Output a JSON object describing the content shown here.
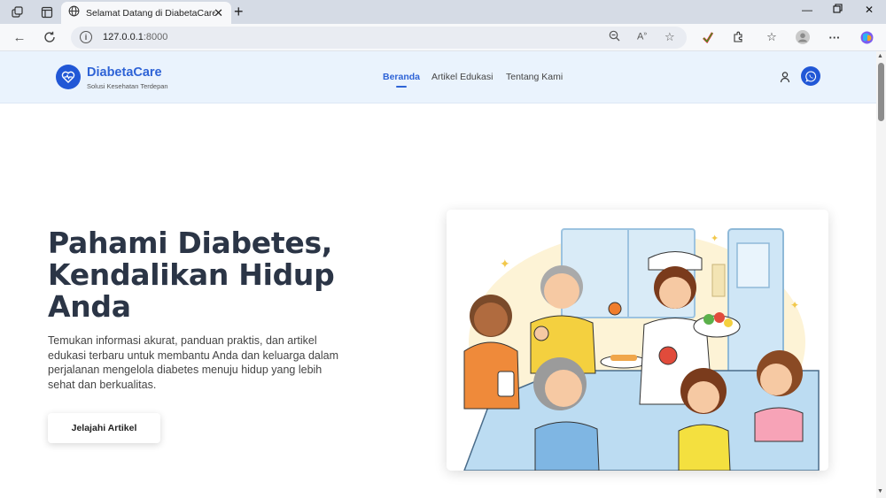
{
  "browser": {
    "tab_title": "Selamat Datang di DiabetaCare",
    "url_host": "127.0.0.1",
    "url_port": ":8000"
  },
  "site": {
    "brand_name": "DiabetaCare",
    "brand_tagline": "Solusi Kesehatan Terdepan",
    "nav": [
      {
        "label": "Beranda"
      },
      {
        "label": "Artikel Edukasi"
      },
      {
        "label": "Tentang Kami"
      }
    ]
  },
  "hero": {
    "title_lines": [
      "Pahami Diabetes,",
      "Kendalikan Hidup",
      "Anda"
    ],
    "subtitle": "Temukan informasi akurat, panduan praktis, dan artikel edukasi terbaru untuk membantu Anda dan keluarga dalam perjalanan mengelola diabetes menuju hidup yang lebih sehat dan berkualitas.",
    "cta_label": "Jelajahi Artikel"
  },
  "colors": {
    "brand_blue": "#2157d6",
    "header_bg": "#eaf3fd",
    "title_text": "#2b3546"
  },
  "icons": {
    "brand": "heart-pulse-icon",
    "user": "user-icon",
    "chat": "whatsapp-icon"
  }
}
